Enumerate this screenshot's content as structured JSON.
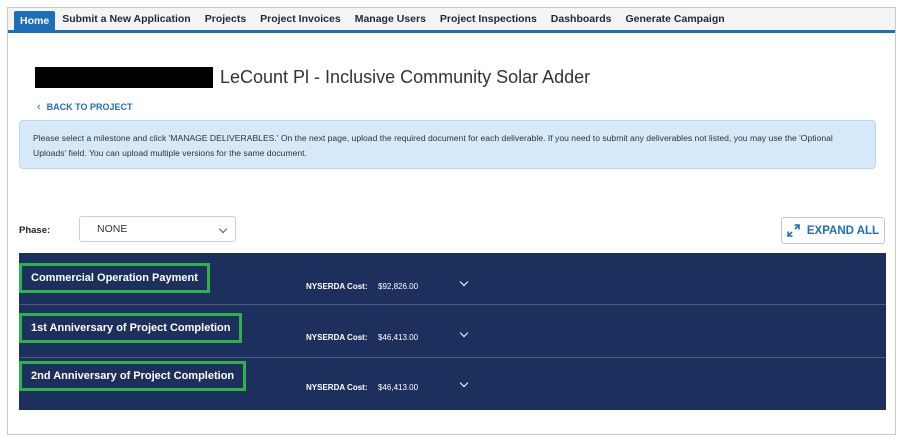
{
  "nav": {
    "items": [
      {
        "label": "Home",
        "active": true
      },
      {
        "label": "Submit a New Application",
        "active": false
      },
      {
        "label": "Projects",
        "active": false
      },
      {
        "label": "Project Invoices",
        "active": false
      },
      {
        "label": "Manage Users",
        "active": false
      },
      {
        "label": "Project Inspections",
        "active": false
      },
      {
        "label": "Dashboards",
        "active": false
      },
      {
        "label": "Generate Campaign",
        "active": false
      }
    ]
  },
  "page": {
    "title": "LeCount Pl - Inclusive Community Solar Adder",
    "back_label": "BACK TO PROJECT",
    "info_text": "Please select a milestone and click 'MANAGE DELIVERABLES.' On the next page, upload the required document for each deliverable. If you need to submit any deliverables not listed, you may use the 'Optional Uploads' field. You can upload multiple versions for the same document."
  },
  "phase": {
    "label": "Phase:",
    "selected": "NONE"
  },
  "expand_label": "EXPAND ALL",
  "milestones": [
    {
      "name": "Commercial Operation Payment",
      "cost_label": "NYSERDA Cost:",
      "cost": "$92,826.00"
    },
    {
      "name": "1st Anniversary of Project Completion",
      "cost_label": "NYSERDA Cost:",
      "cost": "$46,413.00"
    },
    {
      "name": "2nd Anniversary of Project Completion",
      "cost_label": "NYSERDA Cost:",
      "cost": "$46,413.00"
    }
  ],
  "colors": {
    "nav_accent": "#1d6fb8",
    "milestone_bg": "#1d2f5c",
    "highlight": "#2db34a",
    "info_bg": "#d6e9f8"
  }
}
